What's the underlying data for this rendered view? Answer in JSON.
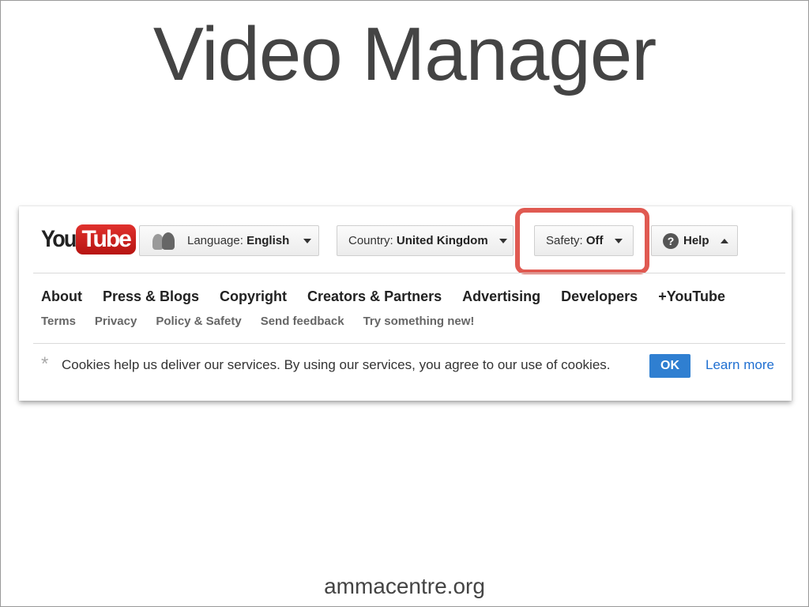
{
  "slide": {
    "title": "Video Manager",
    "footer": "ammacentre.org"
  },
  "header": {
    "logo_you": "You",
    "logo_tube": "Tube",
    "language": {
      "label": "Language: ",
      "value": "English"
    },
    "country": {
      "label": "Country: ",
      "value": "United Kingdom"
    },
    "safety": {
      "label": "Safety: ",
      "value": "Off"
    },
    "help": {
      "label": "Help",
      "icon_glyph": "?"
    }
  },
  "nav": {
    "main": [
      "About",
      "Press & Blogs",
      "Copyright",
      "Creators & Partners",
      "Advertising",
      "Developers",
      "+YouTube"
    ],
    "sub": [
      "Terms",
      "Privacy",
      "Policy & Safety",
      "Send feedback",
      "Try something new!"
    ]
  },
  "cookie": {
    "star": "*",
    "message": "Cookies help us deliver our services. By using our services, you agree to our use of cookies.",
    "ok_label": "OK",
    "learn_more": "Learn more"
  },
  "colors": {
    "highlight": "#e05a52",
    "youtube_red": "#e0312d",
    "ok_button": "#2f7fd1",
    "link": "#1f6fd1"
  }
}
